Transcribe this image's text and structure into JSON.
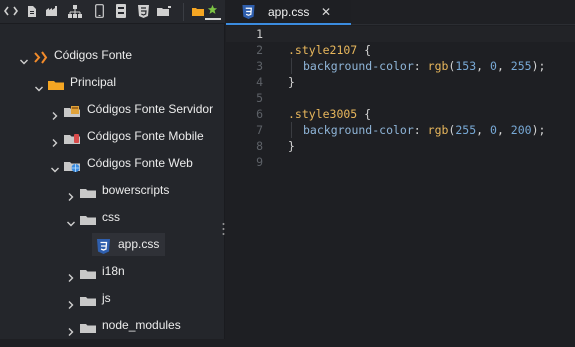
{
  "tree": {
    "root_label": "Códigos Fonte",
    "principal_label": "Principal",
    "servidor_label": "Códigos Fonte Servidor",
    "mobile_label": "Códigos Fonte Mobile",
    "web_label": "Códigos Fonte Web",
    "bowerscripts_label": "bowerscripts",
    "css_label": "css",
    "appcss_label": "app.css",
    "i18n_label": "i18n",
    "js_label": "js",
    "node_modules_label": "node_modules"
  },
  "editor": {
    "tab_label": "app.css",
    "tab_close": "✕",
    "line_numbers": [
      "1",
      "2",
      "3",
      "4",
      "5",
      "6",
      "7",
      "8",
      "9"
    ],
    "code": {
      "l2_selector": ".style2107",
      "l2_brace": " {",
      "l3_prop": "background-color",
      "l3_colon": ": ",
      "l3_fn": "rgb",
      "l3_open": "(",
      "l3_n1": "153",
      "l3_c1": ", ",
      "l3_n2": "0",
      "l3_c2": ", ",
      "l3_n3": "255",
      "l3_close": ");",
      "l4_brace": "}",
      "l6_selector": ".style3005",
      "l6_brace": " {",
      "l7_prop": "background-color",
      "l7_colon": ": ",
      "l7_fn": "rgb",
      "l7_open": "(",
      "l7_n1": "255",
      "l7_c1": ", ",
      "l7_n2": "0",
      "l7_c2": ", ",
      "l7_n3": "200",
      "l7_close": ");",
      "l8_brace": "}"
    }
  },
  "colors": {
    "accent": "#3b8ce0",
    "folder_orange": "#f5a623",
    "folder_gray": "#c8c8c8",
    "css_badge": "#2f5fae"
  }
}
